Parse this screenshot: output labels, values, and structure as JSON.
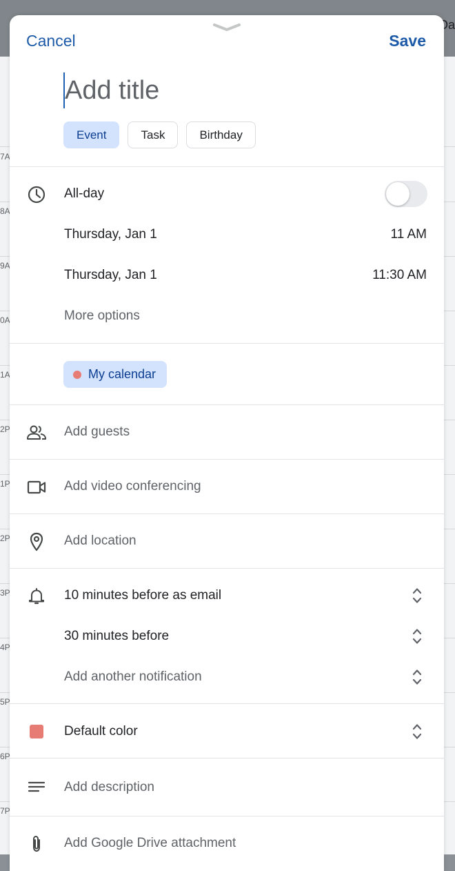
{
  "background": {
    "right_label": "Da",
    "hour_labels": [
      "7A",
      "8A",
      "9A",
      "0A",
      "1A",
      "2P",
      "1P",
      "2P",
      "3P",
      "4P",
      "5P",
      "6P",
      "7P"
    ]
  },
  "header": {
    "cancel_label": "Cancel",
    "save_label": "Save"
  },
  "title": {
    "placeholder": "Add title",
    "value": ""
  },
  "type_chips": [
    {
      "label": "Event",
      "selected": true
    },
    {
      "label": "Task",
      "selected": false
    },
    {
      "label": "Birthday",
      "selected": false
    }
  ],
  "time": {
    "all_day_label": "All-day",
    "all_day_on": false,
    "start_date": "Thursday, Jan 1",
    "start_time": "11 AM",
    "end_date": "Thursday, Jan 1",
    "end_time": "11:30 AM",
    "more_options": "More options"
  },
  "calendar": {
    "label": "My calendar",
    "dot_color": "#e67c73"
  },
  "guests": {
    "label": "Add guests"
  },
  "video": {
    "label": "Add video conferencing"
  },
  "location": {
    "label": "Add location"
  },
  "notifications": {
    "items": [
      "10 minutes before as email",
      "30 minutes before"
    ],
    "add_label": "Add another notification"
  },
  "color": {
    "label": "Default color",
    "value": "#e67c73"
  },
  "description": {
    "label": "Add description"
  },
  "attachment": {
    "label": "Add Google Drive attachment"
  },
  "colors": {
    "accent": "#1c5aa8",
    "chip_selected": "#d3e3fd"
  }
}
